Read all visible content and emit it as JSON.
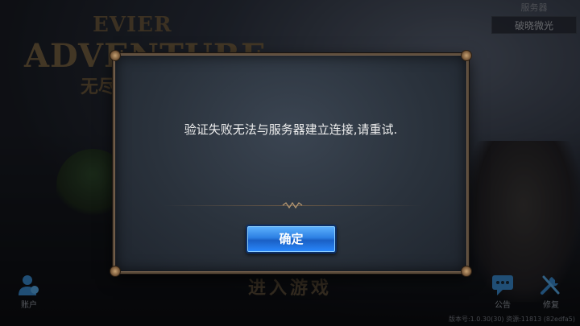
{
  "logo": {
    "line1": "EVIER",
    "line2": "ADVENTURE",
    "line3": "无尽"
  },
  "server": {
    "label": "服务器",
    "value": "破晓微光"
  },
  "enter_game": "进入游戏",
  "account": {
    "label": "账户",
    "icon": "account-icon"
  },
  "notice": {
    "label": "公告",
    "icon": "chat-bubble-icon"
  },
  "repair": {
    "label": "修复",
    "icon": "tools-icon"
  },
  "version": "版本号:1.0.30(30) 资源:11813 (82edfa5)",
  "dialog": {
    "message": "验证失败无法与服务器建立连接,请重试.",
    "confirm_label": "确定"
  },
  "colors": {
    "confirm_button": "#2c7fe3",
    "dialog_border": "#5b4b3a",
    "dialog_bg": "#2a323c"
  }
}
